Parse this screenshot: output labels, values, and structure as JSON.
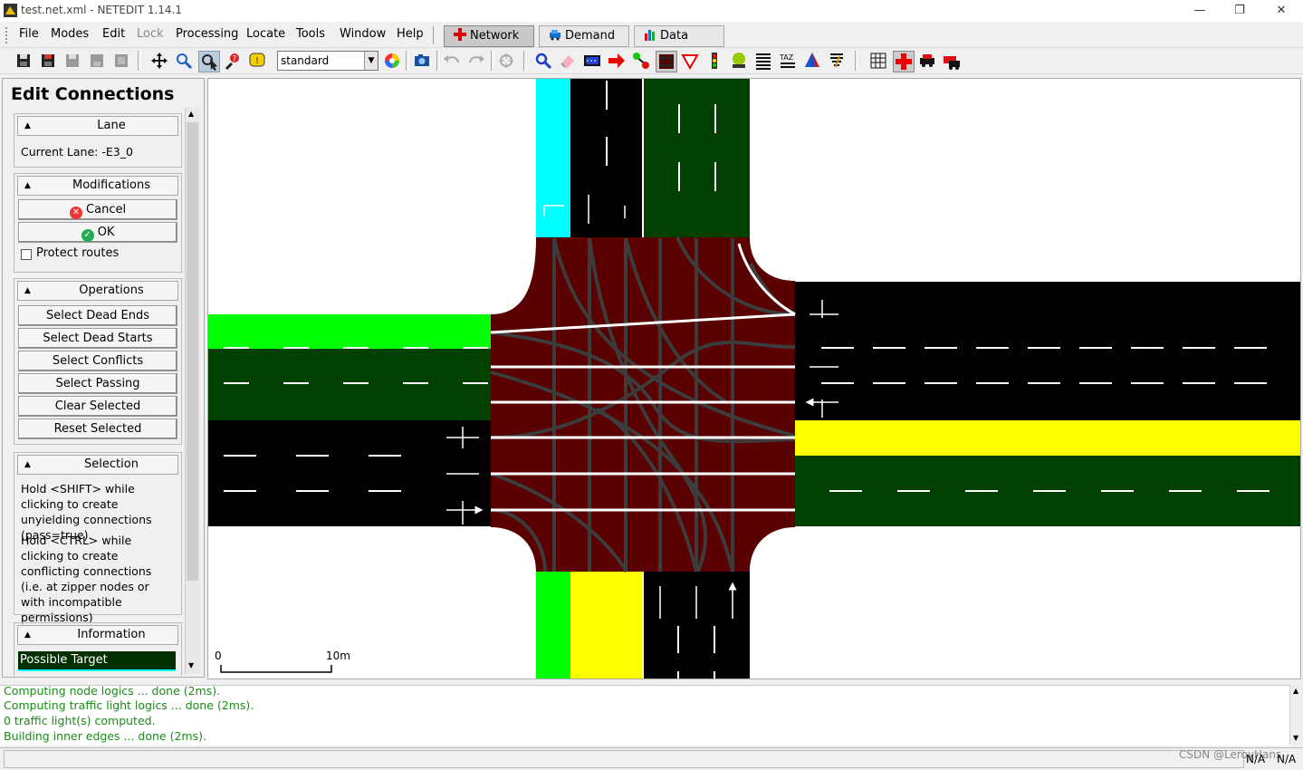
{
  "window": {
    "title": "test.net.xml - NETEDIT 1.14.1",
    "controls": {
      "minimize": "—",
      "restore": "❐",
      "close": "✕"
    }
  },
  "menubar": {
    "items": [
      {
        "label": "File",
        "enabled": true
      },
      {
        "label": "Modes",
        "enabled": true
      },
      {
        "label": "Edit",
        "enabled": true
      },
      {
        "label": "Lock",
        "enabled": false
      },
      {
        "label": "Processing",
        "enabled": true
      },
      {
        "label": "Locate",
        "enabled": true
      },
      {
        "label": "Tools",
        "enabled": true
      },
      {
        "label": "Window",
        "enabled": true
      },
      {
        "label": "Help",
        "enabled": true
      }
    ],
    "supermodes": [
      {
        "label": "Network",
        "active": true
      },
      {
        "label": "Demand",
        "active": false
      },
      {
        "label": "Data",
        "active": false
      }
    ]
  },
  "toolbar": {
    "scheme": "standard",
    "icons": [
      "save-icon",
      "save-as-icon",
      "save-additionals-icon",
      "save-demand-icon",
      "save-data-icon",
      "pan-icon",
      "zoom-icon",
      "select-icon",
      "inspect-help-icon",
      "info-icon",
      "color-wheel-icon",
      "screenshot-icon",
      "undo-icon",
      "redo-icon",
      "recompute-icon",
      "locate-icon",
      "delete-icon",
      "select-mode-icon",
      "move-icon",
      "create-edge-icon",
      "connection-icon",
      "prohibition-icon",
      "crossing-icon",
      "tls-icon",
      "additional-icon",
      "wire-icon",
      "taz-icon",
      "shape-icon",
      "decal-icon",
      "grid-icon",
      "junction-icon",
      "vehicle-icon",
      "vehicle-stop-icon"
    ]
  },
  "leftpanel": {
    "title": "Edit Connections",
    "lane": {
      "header": "Lane",
      "current": "Current Lane: -E3_0"
    },
    "modifications": {
      "header": "Modifications",
      "cancel": "Cancel",
      "ok": "OK",
      "protect_routes": "Protect routes",
      "protect_checked": false
    },
    "operations": {
      "header": "Operations",
      "buttons": [
        "Select Dead Ends",
        "Select Dead Starts",
        "Select Conflicts",
        "Select Passing",
        "Clear Selected",
        "Reset Selected"
      ]
    },
    "selection": {
      "header": "Selection",
      "para1": "Hold <SHIFT> while clicking to create unyielding connections (pass=true).",
      "para2": "Hold <CTRL> while clicking to create conflicting connections (i.e. at zipper nodes or with incompatible permissions)"
    },
    "information": {
      "header": "Information",
      "legend": [
        {
          "label": "Possible Target",
          "color": "#003000"
        }
      ]
    }
  },
  "canvas": {
    "scale_start": "0",
    "scale_end": "10m",
    "colors": {
      "background": "#ffffff",
      "junction": "#5a0000",
      "cyan": "#00ffff",
      "green": "#00ff00",
      "darkgreen": "#004000",
      "yellow": "#ffff00",
      "black": "#000000",
      "connection": "#3c3c3c"
    }
  },
  "messages": [
    "Computing node logics ... done (2ms).",
    "Computing traffic light logics ... done (2ms).",
    " 0 traffic light(s) computed.",
    "Building inner edges ... done (2ms)."
  ],
  "statusbar": {
    "x": "N/A",
    "y": "N/A",
    "watermark": "CSDN @LeroyHans"
  }
}
